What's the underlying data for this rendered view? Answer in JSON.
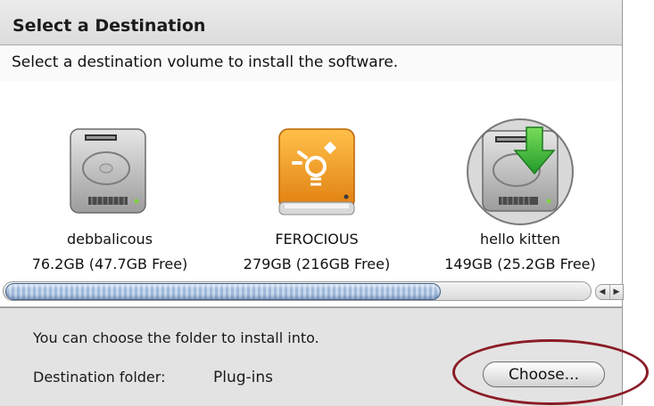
{
  "header": {
    "title": "Select a Destination"
  },
  "instruction": "Select a destination volume to install the software.",
  "volumes": [
    {
      "name": "debbalicous",
      "size": "76.2GB (47.7GB Free)",
      "icon": "internal-hard-drive-icon"
    },
    {
      "name": "FEROCIOUS",
      "size": "279GB (216GB Free)",
      "icon": "firewire-drive-icon"
    },
    {
      "name": "hello kitten",
      "size": "149GB (25.2GB Free)",
      "icon": "selected-hard-drive-icon",
      "selected": true
    }
  ],
  "folder": {
    "hint": "You can choose the folder to install into.",
    "label": "Destination folder:",
    "value": "Plug-ins",
    "choose_label": "Choose..."
  },
  "colors": {
    "firewire_orange": "#f29a1f",
    "install_arrow_green": "#38b13a",
    "annotation_red": "#8a1c26",
    "scroll_thumb_blue": "#9fb9d9"
  }
}
